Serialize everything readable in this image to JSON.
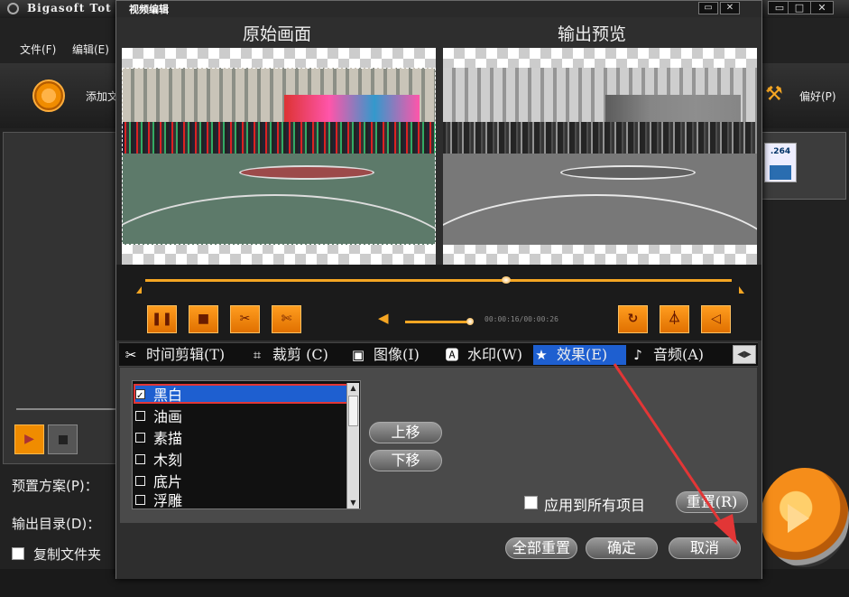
{
  "app": {
    "title": "Bigasoft Tot",
    "menu": [
      "文件(F)",
      "编辑(E)"
    ],
    "toolbar": {
      "add_label": "添加文",
      "prefs_label": "偏好(P)"
    },
    "file_badge": ".264",
    "preset_label": "预置方案(P)：",
    "output_dir_label": "输出目录(D)：",
    "copy_folder_label": "复制文件夹"
  },
  "dialog": {
    "title": "视频编辑",
    "original_title": "原始画面",
    "output_title": "输出预览",
    "time": "00:00:16/00:00:26",
    "tabs": [
      {
        "label": "时间剪辑(T)",
        "icon": "scissors-icon"
      },
      {
        "label": "裁剪 (C)",
        "icon": "crop-icon"
      },
      {
        "label": "图像(I)",
        "icon": "image-icon"
      },
      {
        "label": "水印(W)",
        "icon": "watermark-icon"
      },
      {
        "label": "效果(E)",
        "icon": "star-icon",
        "active": true
      },
      {
        "label": "音频(A)",
        "icon": "music-icon"
      }
    ],
    "effects": [
      {
        "label": "黑白",
        "checked": true,
        "selected": true
      },
      {
        "label": "油画",
        "checked": false
      },
      {
        "label": "素描",
        "checked": false
      },
      {
        "label": "木刻",
        "checked": false
      },
      {
        "label": "底片",
        "checked": false
      },
      {
        "label": "浮雕",
        "checked": false
      }
    ],
    "move_up": "上移",
    "move_down": "下移",
    "apply_all": "应用到所有项目",
    "reset": "重置(R)",
    "reset_all": "全部重置",
    "ok": "确定",
    "cancel": "取消",
    "progress_fraction": 0.63,
    "volume_fraction": 0.95
  },
  "colors": {
    "accent": "#f5a623",
    "selection": "#1e5fd0",
    "annotation": "#e23636"
  }
}
